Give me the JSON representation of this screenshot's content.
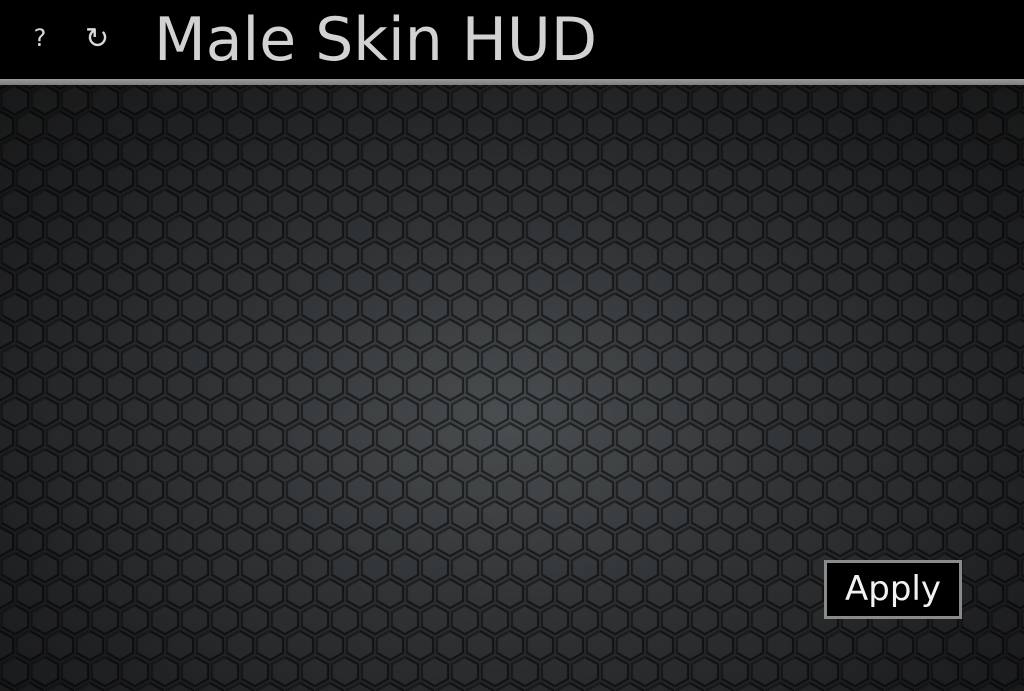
{
  "header": {
    "title": "Male Skin HUD",
    "help_label": "?",
    "reload_label": "↻"
  },
  "icons": {
    "help": "question-mark-icon",
    "reload": "reload-icon"
  },
  "main": {
    "background": "hexagon-pattern",
    "apply_label": "Apply"
  },
  "colors": {
    "header_bg": "#000000",
    "divider": "#8c8c8c",
    "title_text": "#d2d2d2",
    "panel_center": "#454a4d",
    "panel_edge": "#111213",
    "button_bg": "#000000",
    "button_border": "#8a8a8a",
    "button_text": "#f2f2f2"
  }
}
